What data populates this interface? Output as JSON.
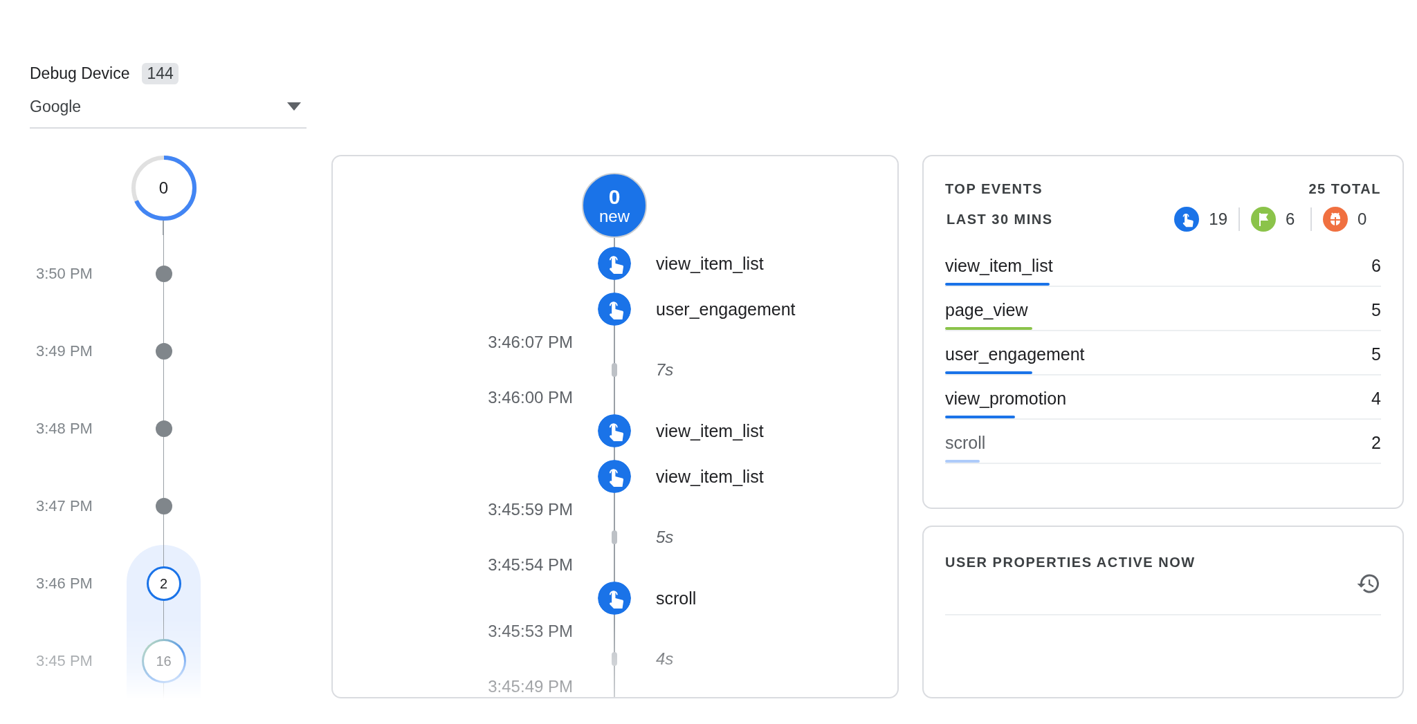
{
  "device": {
    "label": "Debug Device",
    "count": "144",
    "value": "Google"
  },
  "minutes": {
    "counter": {
      "count": "0",
      "level": 0.68
    },
    "items": [
      {
        "time": "3:50 PM",
        "kind": "dot",
        "selected": false
      },
      {
        "time": "3:49 PM",
        "kind": "dot",
        "selected": false
      },
      {
        "time": "3:48 PM",
        "kind": "dot",
        "selected": false
      },
      {
        "time": "3:47 PM",
        "kind": "dot",
        "selected": false
      },
      {
        "time": "3:46 PM",
        "kind": "count",
        "count": "2",
        "selected": true
      },
      {
        "time": "3:45 PM",
        "kind": "mixed-count",
        "count": "16",
        "selected": true
      }
    ]
  },
  "stream": {
    "new_count": "0",
    "new_label": "new",
    "entries": [
      {
        "kind": "event",
        "name": "view_item_list"
      },
      {
        "kind": "event",
        "name": "user_engagement"
      },
      {
        "kind": "time",
        "text": "3:46:07 PM"
      },
      {
        "kind": "gap",
        "text": "7s"
      },
      {
        "kind": "time",
        "text": "3:46:00 PM"
      },
      {
        "kind": "event",
        "name": "view_item_list"
      },
      {
        "kind": "event",
        "name": "view_item_list"
      },
      {
        "kind": "time",
        "text": "3:45:59 PM"
      },
      {
        "kind": "gap",
        "text": "5s"
      },
      {
        "kind": "time",
        "text": "3:45:54 PM"
      },
      {
        "kind": "event",
        "name": "scroll"
      },
      {
        "kind": "time",
        "text": "3:45:53 PM"
      },
      {
        "kind": "gap",
        "text": "4s"
      },
      {
        "kind": "time",
        "text": "3:45:49 PM"
      }
    ]
  },
  "top_events": {
    "title": "TOP EVENTS",
    "total": "25 TOTAL",
    "period": "LAST 30 MINS",
    "summary": [
      {
        "kind": "touch",
        "count": "19",
        "color": "#1a73e8"
      },
      {
        "kind": "flag",
        "count": "6",
        "color": "#8bc34a"
      },
      {
        "kind": "bug",
        "count": "0",
        "color": "#f07040"
      }
    ],
    "rows": [
      {
        "name": "view_item_list",
        "count": "6",
        "level": 0.24,
        "color": "#1a73e8"
      },
      {
        "name": "page_view",
        "count": "5",
        "level": 0.2,
        "color": "#8bc34a"
      },
      {
        "name": "user_engagement",
        "count": "5",
        "level": 0.2,
        "color": "#1a73e8"
      },
      {
        "name": "view_promotion",
        "count": "4",
        "level": 0.16,
        "color": "#1a73e8"
      },
      {
        "name": "scroll",
        "count": "2",
        "level": 0.08,
        "color": "#aecbfa"
      }
    ]
  },
  "user_properties": {
    "title": "USER PROPERTIES ACTIVE NOW"
  }
}
